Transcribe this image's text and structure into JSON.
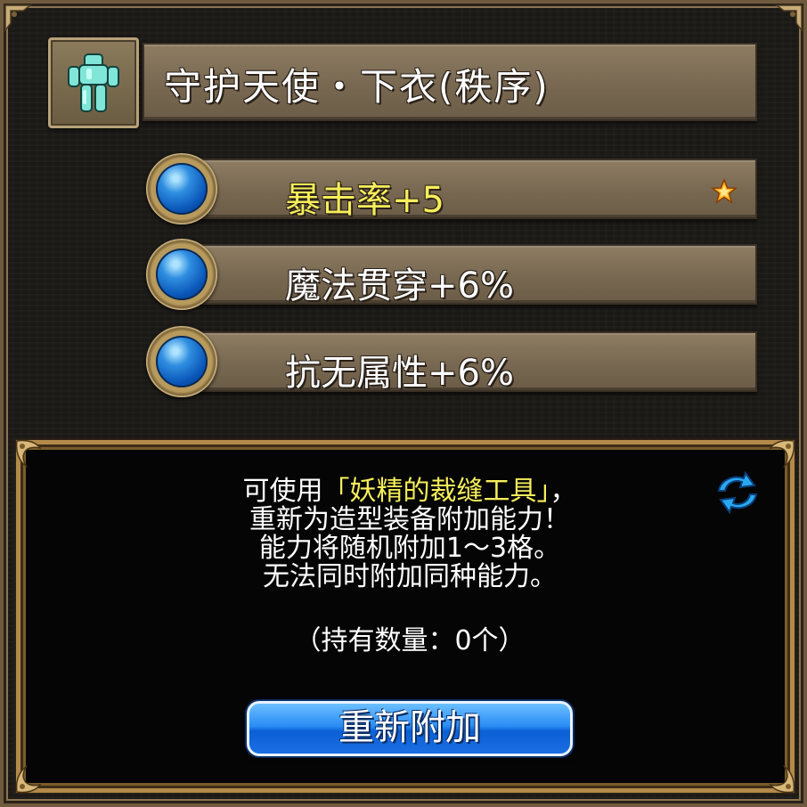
{
  "item": {
    "name": "守护天使・下衣(秩序)",
    "icon": "armor-icon"
  },
  "attributes": [
    {
      "label": "暴击率+5",
      "highlighted": true,
      "color": "#f6ee5a",
      "marker_icon": "star-icon"
    },
    {
      "label": "魔法贯穿+6%",
      "highlighted": false,
      "color": "#ffffff"
    },
    {
      "label": "抗无属性+6%",
      "highlighted": false,
      "color": "#ffffff"
    }
  ],
  "info": {
    "line1_prefix": "可使用",
    "tool_name": "「妖精的裁缝工具」",
    "line1_suffix": "，",
    "line2": "重新为造型装备附加能力！",
    "line3": "能力将随机附加1～3格。",
    "line4": "无法同时附加同种能力。",
    "owned": "（持有数量：0个）",
    "refresh_icon": "refresh-icon"
  },
  "button": {
    "reattach_label": "重新附加"
  },
  "colors": {
    "highlight": "#f6ee5a",
    "button_blue": "#2a8cf5",
    "panel_border": "#b38a4a"
  }
}
